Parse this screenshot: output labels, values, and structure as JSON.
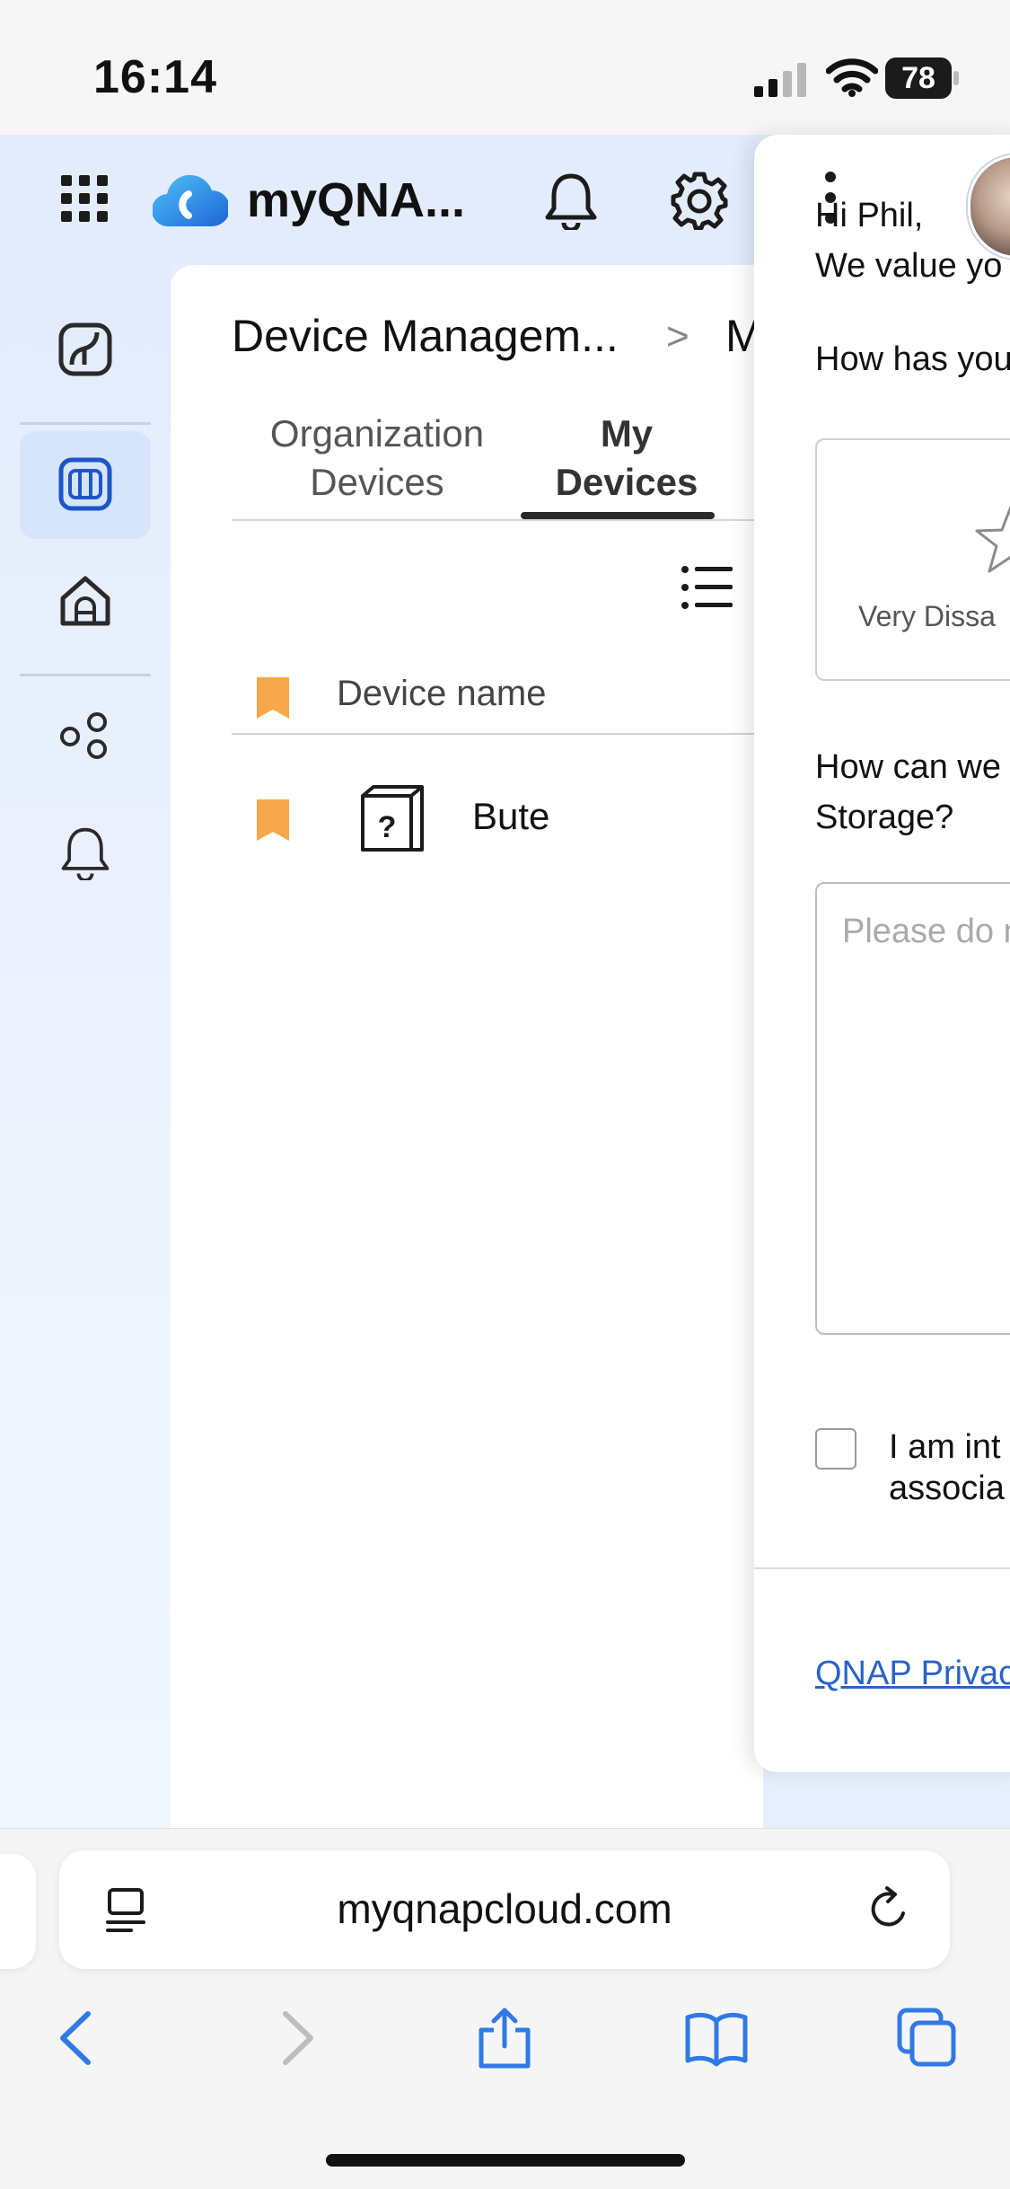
{
  "status_bar": {
    "time": "16:14",
    "battery": "78"
  },
  "app": {
    "brand": "myQNA...",
    "breadcrumb": {
      "current": "Device Managem...",
      "separator": ">",
      "next": "M"
    },
    "tabs": [
      {
        "line1": "Organization",
        "line2": "Devices"
      },
      {
        "line1": "My",
        "line2": "Devices"
      }
    ],
    "list": {
      "column_header": "Device name",
      "rows": [
        {
          "name": "Bute",
          "icon_glyph": "?"
        }
      ]
    },
    "colors": {
      "accent": "#1e56c8",
      "bookmark": "#f6a84a",
      "rail_active": "#d6e4fc"
    }
  },
  "feedback": {
    "greeting": "Hi Phil,",
    "intro": "We value yo",
    "q1": "How has you",
    "rating_label": "Very Dissa",
    "q2_line1": "How can we",
    "q2_line2": "Storage?",
    "placeholder": "Please do n",
    "consent_line1": "I am int",
    "consent_line2": "associa",
    "privacy_link": "QNAP Privac"
  },
  "browser": {
    "url": "myqnapcloud.com"
  }
}
